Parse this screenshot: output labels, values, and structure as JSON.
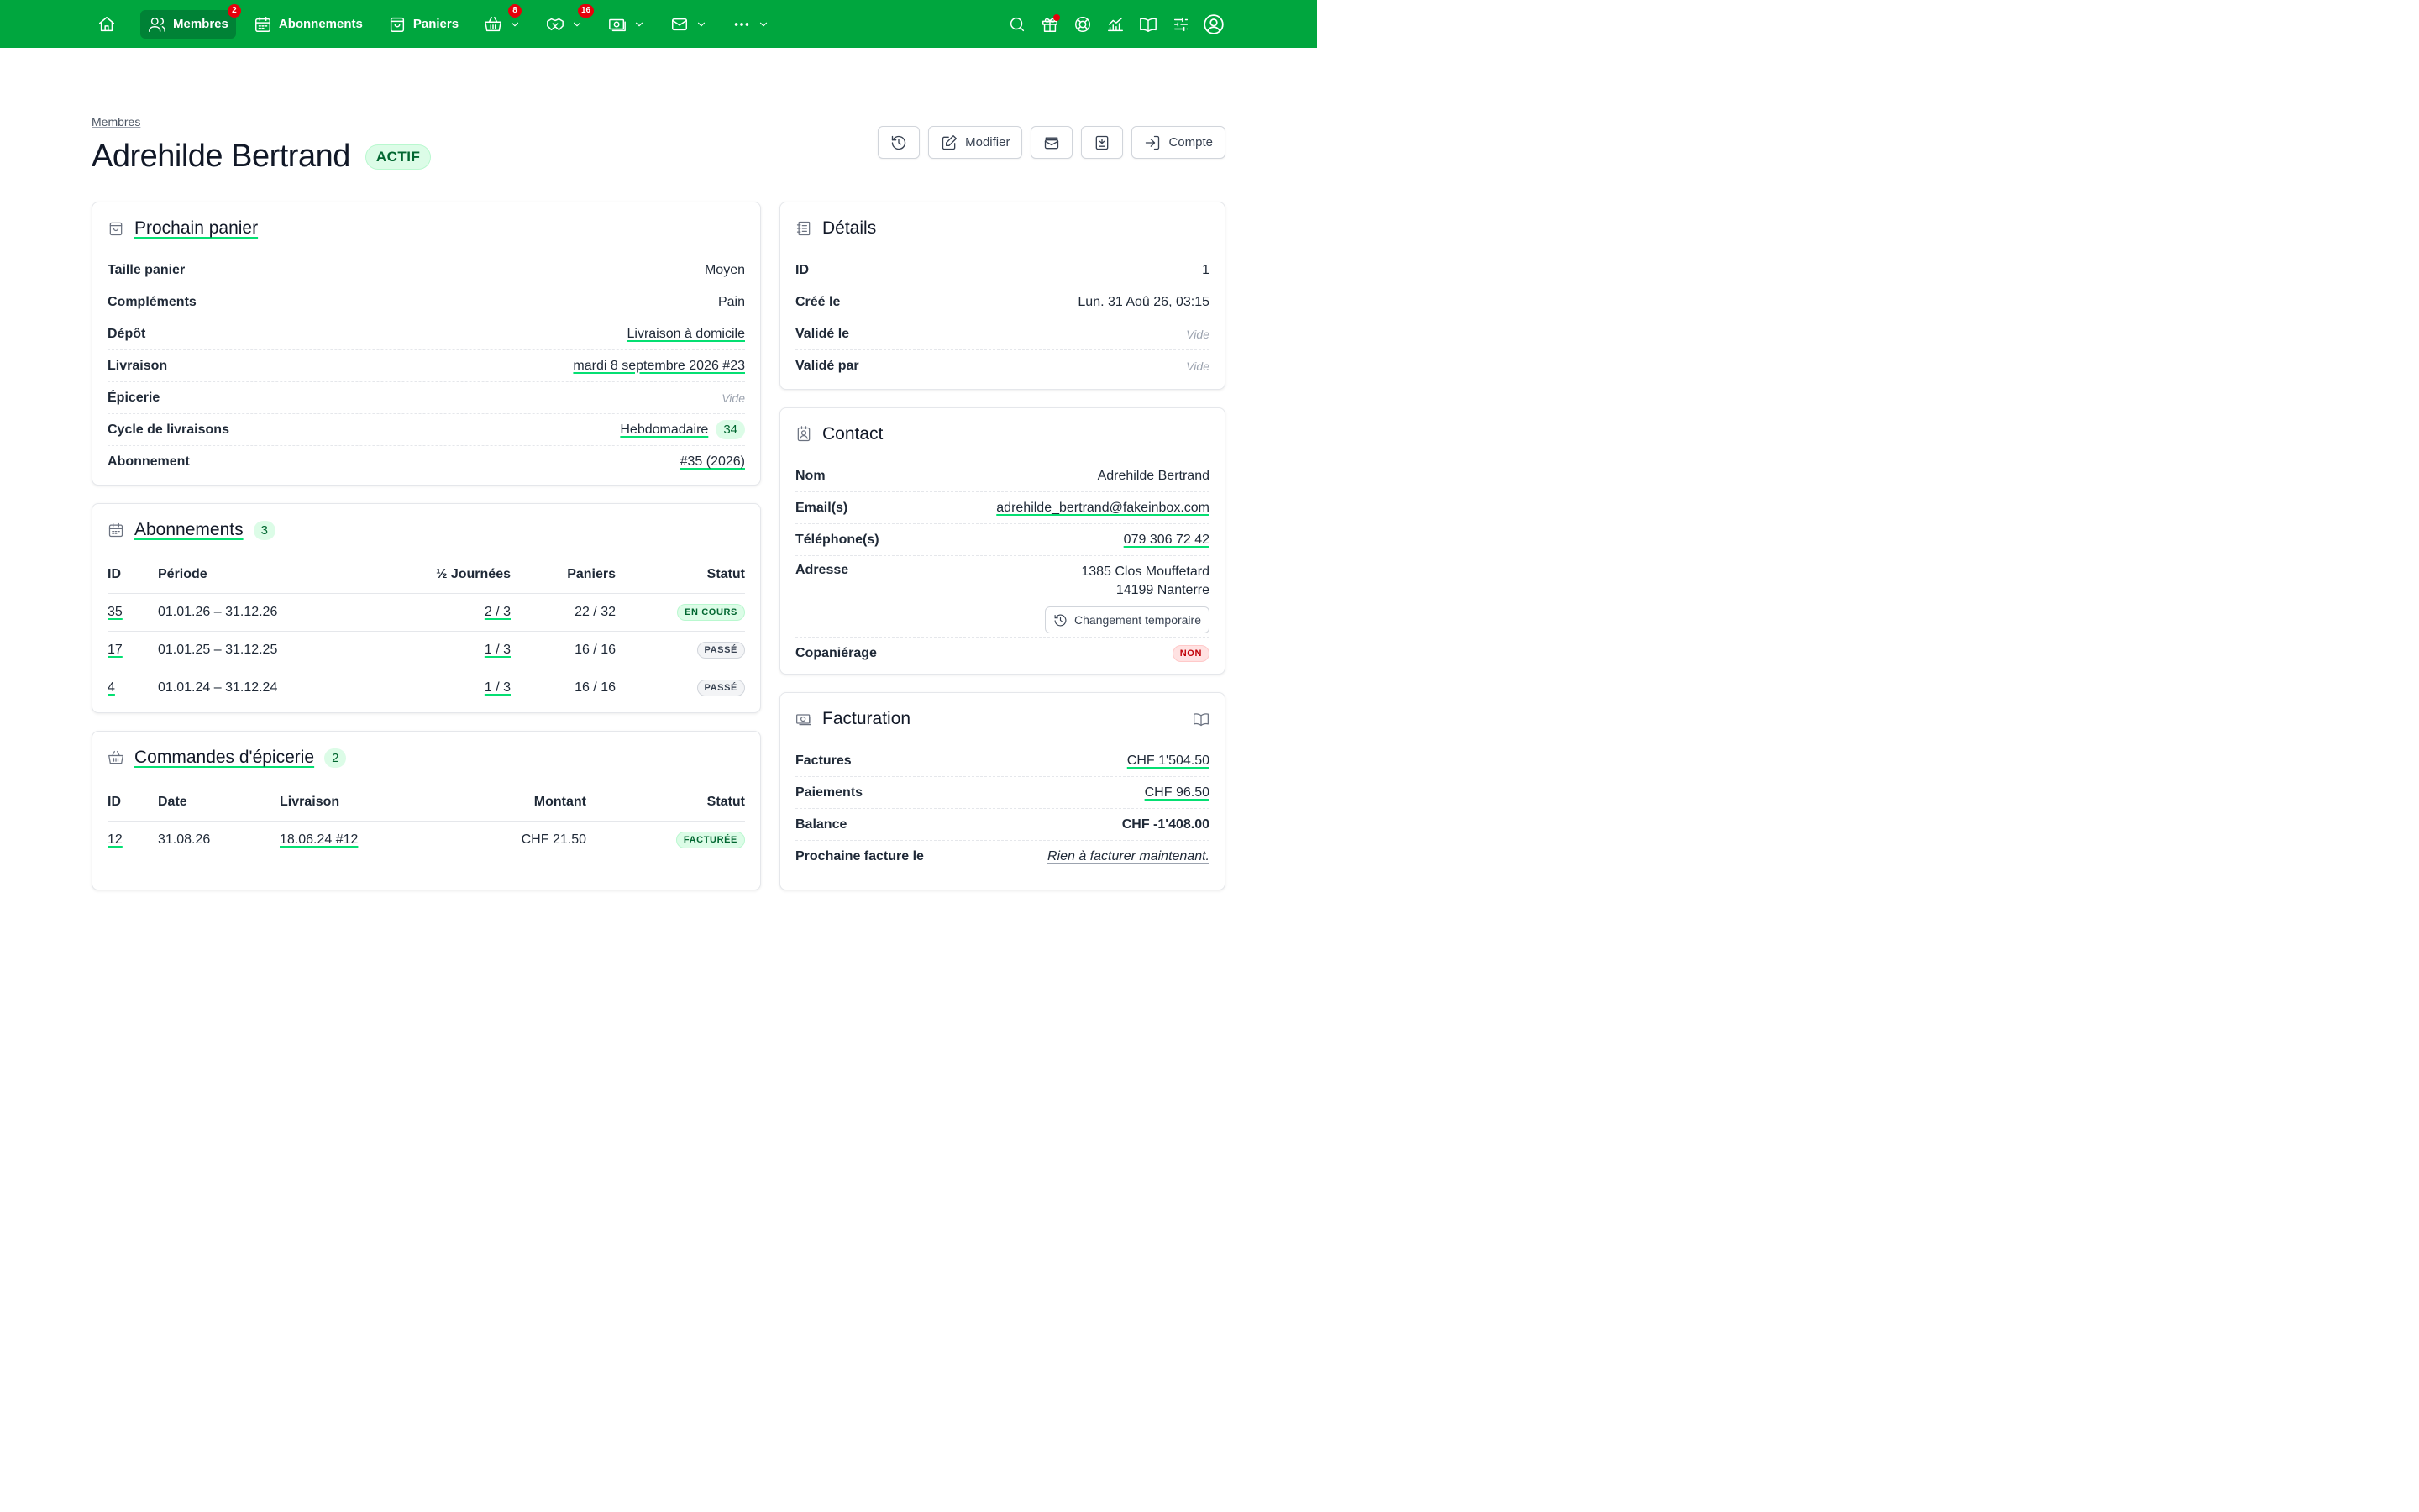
{
  "nav": {
    "items": [
      {
        "label": "Membres",
        "badge": "2"
      },
      {
        "label": "Abonnements"
      },
      {
        "label": "Paniers"
      }
    ],
    "icon_badges": {
      "shop": "8",
      "handshake": "16"
    }
  },
  "header": {
    "breadcrumb": "Membres",
    "title": "Adrehilde Bertrand",
    "status": "ACTIF",
    "actions": {
      "edit": "Modifier",
      "account": "Compte"
    }
  },
  "next_basket": {
    "title": "Prochain panier",
    "rows": [
      {
        "label": "Taille panier",
        "value": "Moyen"
      },
      {
        "label": "Compléments",
        "value": "Pain"
      },
      {
        "label": "Dépôt",
        "value": "Livraison à domicile"
      },
      {
        "label": "Livraison",
        "value": "mardi 8 septembre 2026 #23"
      },
      {
        "label": "Épicerie",
        "value": "Vide"
      },
      {
        "label": "Cycle de livraisons",
        "value": "Hebdomadaire",
        "badge": "34"
      },
      {
        "label": "Abonnement",
        "value": "#35 (2026)"
      }
    ]
  },
  "memberships": {
    "title": "Abonnements",
    "count": "3",
    "columns": [
      "ID",
      "Période",
      "½ Journées",
      "Paniers",
      "Statut"
    ],
    "rows": [
      {
        "id": "35",
        "period": "01.01.26 – 31.12.26",
        "half_days": "2 / 3",
        "baskets": "22 / 32",
        "status": "EN COURS"
      },
      {
        "id": "17",
        "period": "01.01.25 – 31.12.25",
        "half_days": "1 / 3",
        "baskets": "16 / 16",
        "status": "PASSÉ"
      },
      {
        "id": "4",
        "period": "01.01.24 – 31.12.24",
        "half_days": "1 / 3",
        "baskets": "16 / 16",
        "status": "PASSÉ"
      }
    ]
  },
  "orders": {
    "title": "Commandes d'épicerie",
    "count": "2",
    "columns": [
      "ID",
      "Date",
      "Livraison",
      "Montant",
      "Statut"
    ],
    "rows": [
      {
        "id": "12",
        "date": "31.08.26",
        "delivery": "18.06.24 #12",
        "amount": "CHF 21.50",
        "status": "FACTURÉE"
      }
    ]
  },
  "details": {
    "title": "Détails",
    "rows": [
      {
        "label": "ID",
        "value": "1"
      },
      {
        "label": "Créé le",
        "value": "Lun. 31 Aoû 26, 03:15"
      },
      {
        "label": "Validé le",
        "value": "Vide"
      },
      {
        "label": "Validé par",
        "value": "Vide"
      }
    ]
  },
  "contact": {
    "title": "Contact",
    "name_label": "Nom",
    "name": "Adrehilde Bertrand",
    "email_label": "Email(s)",
    "email": "adrehilde_bertrand@fakeinbox.com",
    "phone_label": "Téléphone(s)",
    "phone": "079 306 72 42",
    "address_label": "Adresse",
    "address_line1": "1385 Clos Mouffetard",
    "address_line2": "14199 Nanterre",
    "temp_change": "Changement temporaire",
    "cobasket_label": "Copaniérage",
    "cobasket": "NON"
  },
  "billing": {
    "title": "Facturation",
    "invoices_label": "Factures",
    "invoices": "CHF 1'504.50",
    "payments_label": "Paiements",
    "payments": "CHF 96.50",
    "balance_label": "Balance",
    "balance": "CHF -1'408.00",
    "next_invoice_label": "Prochaine facture le",
    "next_invoice": "Rien à facturer maintenant."
  }
}
